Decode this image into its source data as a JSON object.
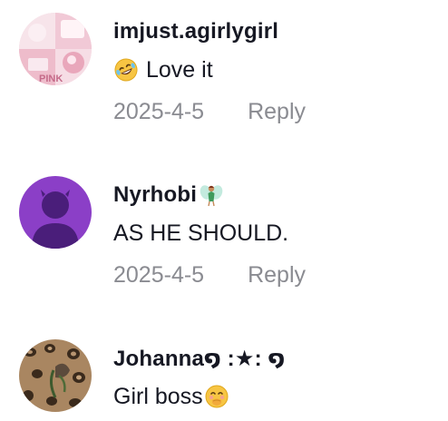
{
  "comments": [
    {
      "username": "imjust.agirlygirl",
      "text": "Love it",
      "date": "2025-4-5",
      "reply_label": "Reply",
      "avatar_text": "PINK"
    },
    {
      "username": "Nyrhobi",
      "text": "AS HE SHOULD.",
      "date": "2025-4-5",
      "reply_label": "Reply"
    },
    {
      "username": "Johanna໑ :★: ໑",
      "text": "Girl boss"
    }
  ],
  "colors": {
    "meta_gray": "#8a8b91",
    "text": "#161823",
    "default_avatar_bg": "#8b3fc7",
    "default_avatar_fg": "#4a1e7a"
  }
}
